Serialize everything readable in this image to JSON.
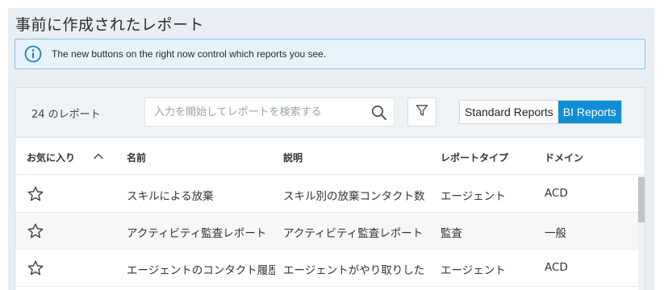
{
  "page": {
    "title": "事前に作成されたレポート"
  },
  "info_banner": {
    "icon": "info-icon",
    "text": "The new buttons on the right now control which reports you see."
  },
  "toolbar": {
    "count_label": "24 のレポート",
    "search_placeholder": "入力を開始してレポートを検索する",
    "toggle": {
      "standard_label": "Standard Reports",
      "bi_label": "BI Reports",
      "active": "BI Reports"
    }
  },
  "table": {
    "headers": {
      "favorite": "お気に入り",
      "name": "名前",
      "description": "説明",
      "report_type": "レポートタイプ",
      "domain": "ドメイン"
    },
    "rows": [
      {
        "name": "スキルによる放棄",
        "description": "スキル別の放棄コンタクト数",
        "report_type": "エージェント",
        "domain": "ACD"
      },
      {
        "name": "アクティビティ監査レポート",
        "description": "アクティビティ監査レポート",
        "report_type": "監査",
        "domain": "一般"
      },
      {
        "name": "エージェントのコンタクト履歴",
        "description": "エージェントがやり取りした",
        "report_type": "エージェント",
        "domain": "ACD"
      }
    ]
  },
  "colors": {
    "accent": "#0f8ed6",
    "banner_bg": "#e6f3fb",
    "banner_border": "#7fbfe3",
    "page_bg": "#e9eef4"
  }
}
